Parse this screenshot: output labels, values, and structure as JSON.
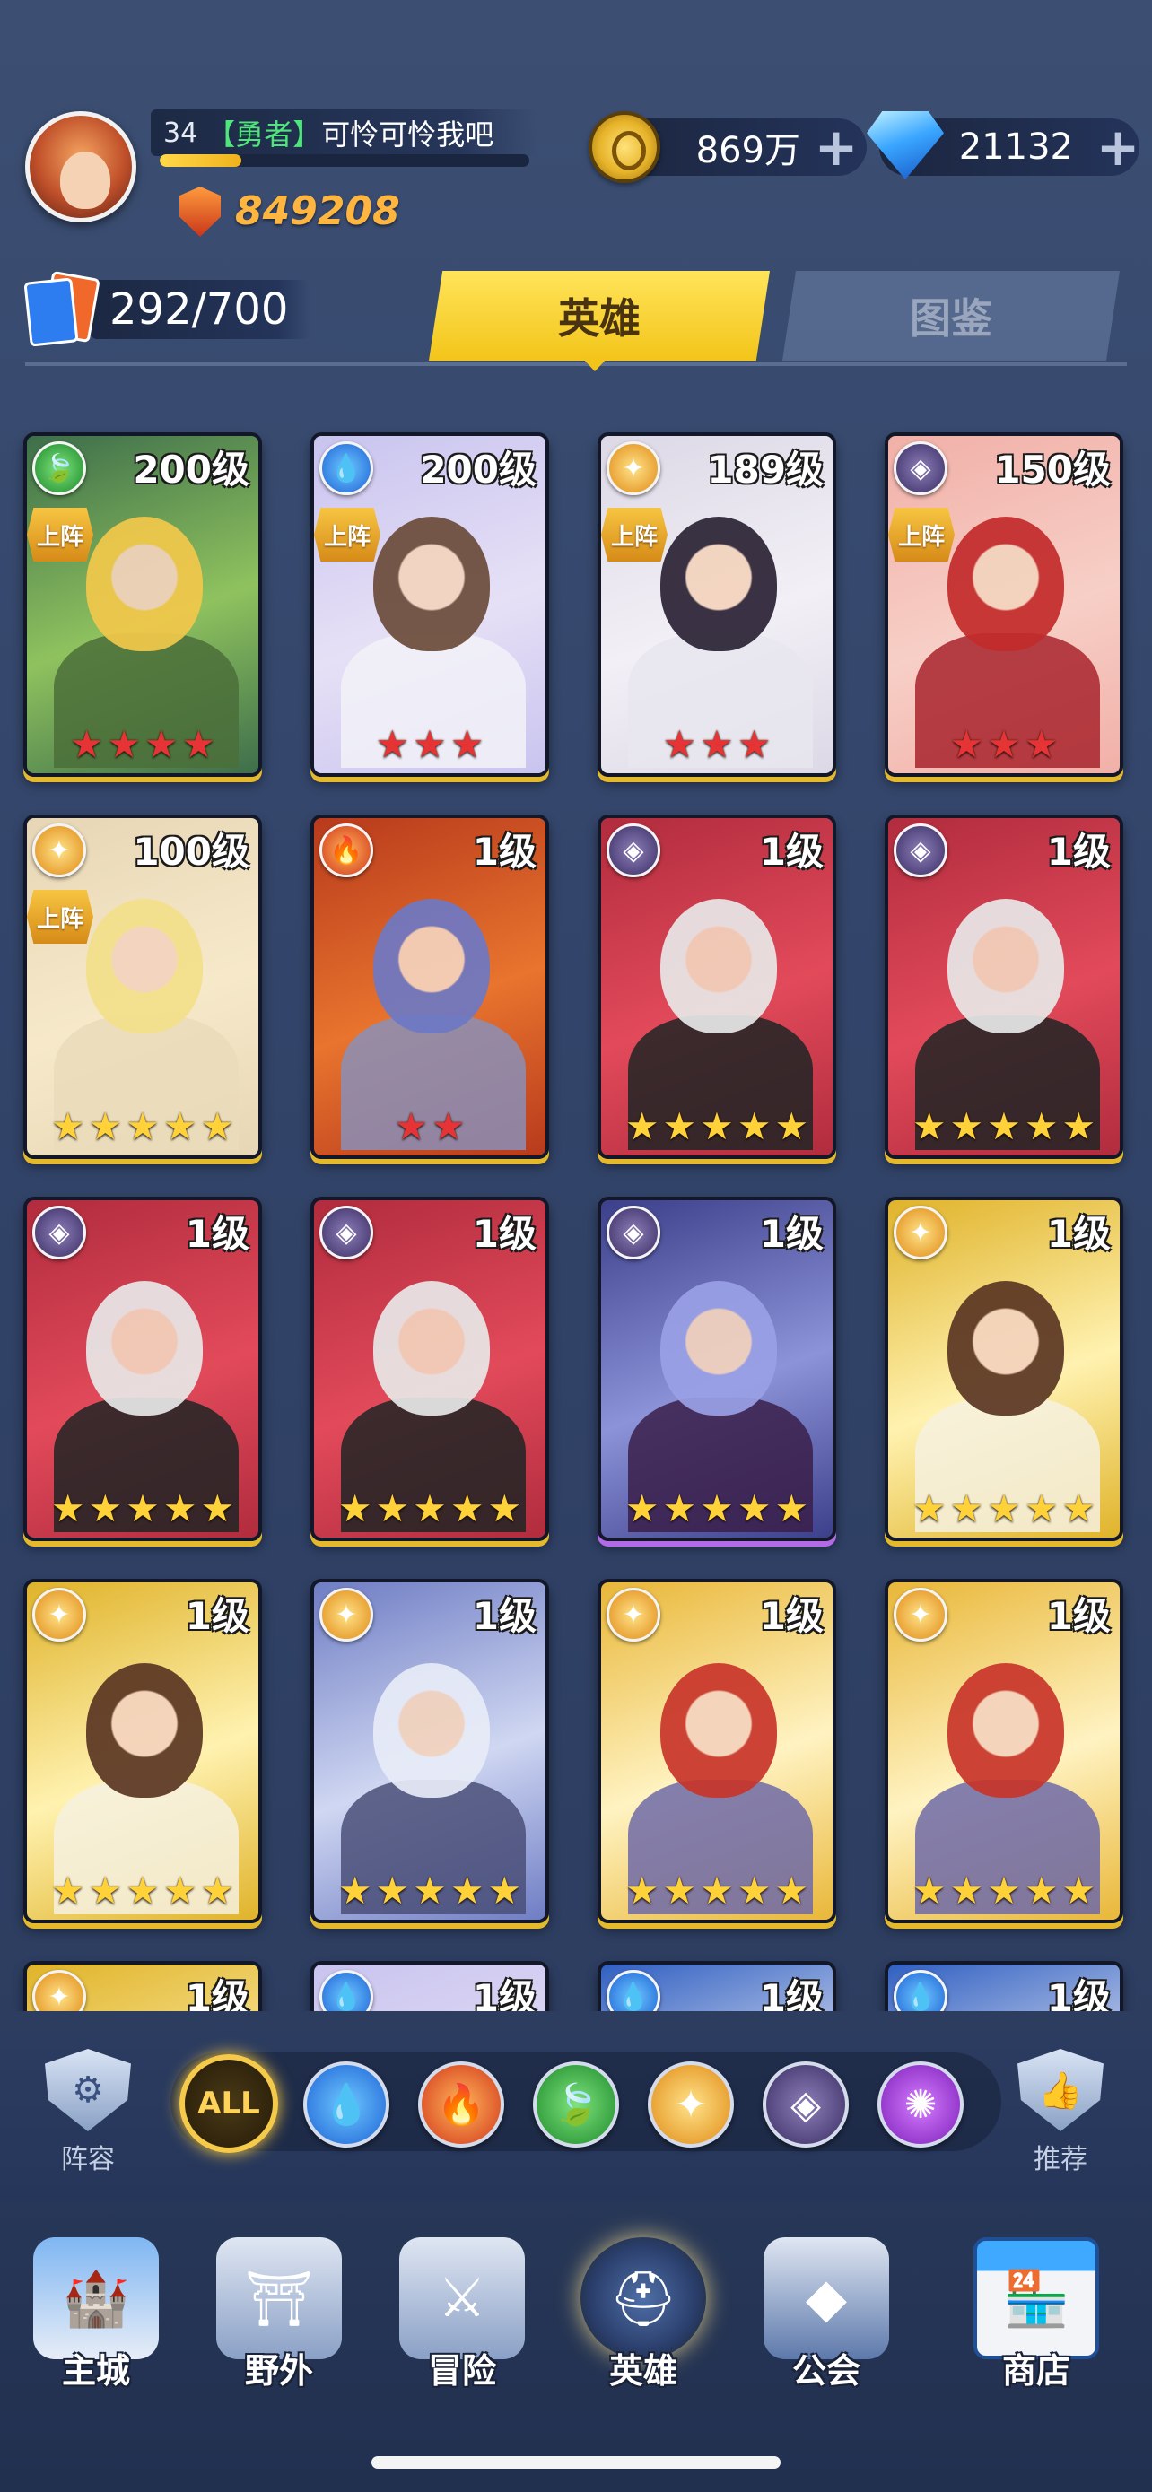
{
  "player": {
    "level": "34",
    "title_tag": "【勇者】",
    "name": "可怜可怜我吧",
    "exp_progress": 0.22,
    "power": "849208"
  },
  "resources": {
    "gold": "869万",
    "gems": "21132",
    "plus_label": "+"
  },
  "hero_count": "292/700",
  "tabs": [
    {
      "label": "英雄",
      "active": true
    },
    {
      "label": "图鉴",
      "active": false
    }
  ],
  "deploy_label": "上阵",
  "heroes": [
    {
      "level": "200级",
      "faction": "nature",
      "deployed": true,
      "stars": 4,
      "star_color": "red",
      "palette": "gold-green"
    },
    {
      "level": "200级",
      "faction": "water",
      "deployed": true,
      "stars": 3,
      "star_color": "red",
      "palette": "lavender"
    },
    {
      "level": "189级",
      "faction": "light",
      "deployed": true,
      "stars": 3,
      "star_color": "red",
      "palette": "dark-white"
    },
    {
      "level": "150级",
      "faction": "void",
      "deployed": true,
      "stars": 3,
      "star_color": "red",
      "palette": "crimson"
    },
    {
      "level": "100级",
      "faction": "light",
      "deployed": true,
      "stars": 5,
      "star_color": "gold",
      "palette": "blonde"
    },
    {
      "level": "1级",
      "faction": "fire",
      "deployed": false,
      "stars": 2,
      "star_color": "red",
      "palette": "brute"
    },
    {
      "level": "1级",
      "faction": "void",
      "deployed": false,
      "stars": 5,
      "star_color": "gold",
      "palette": "skull"
    },
    {
      "level": "1级",
      "faction": "void",
      "deployed": false,
      "stars": 5,
      "star_color": "gold",
      "palette": "skull"
    },
    {
      "level": "1级",
      "faction": "void",
      "deployed": false,
      "stars": 5,
      "star_color": "gold",
      "palette": "skull"
    },
    {
      "level": "1级",
      "faction": "void",
      "deployed": false,
      "stars": 5,
      "star_color": "gold",
      "palette": "skull"
    },
    {
      "level": "1级",
      "faction": "void",
      "deployed": false,
      "stars": 5,
      "star_color": "gold",
      "palette": "vampire"
    },
    {
      "level": "1级",
      "faction": "light",
      "deployed": false,
      "stars": 5,
      "star_color": "gold",
      "palette": "goddess"
    },
    {
      "level": "1级",
      "faction": "light",
      "deployed": false,
      "stars": 5,
      "star_color": "gold",
      "palette": "goddess"
    },
    {
      "level": "1级",
      "faction": "light",
      "deployed": false,
      "stars": 5,
      "star_color": "gold",
      "palette": "silver-elf"
    },
    {
      "level": "1级",
      "faction": "light",
      "deployed": false,
      "stars": 5,
      "star_color": "gold",
      "palette": "helm-red"
    },
    {
      "level": "1级",
      "faction": "light",
      "deployed": false,
      "stars": 5,
      "star_color": "gold",
      "palette": "helm-red"
    },
    {
      "level": "1级",
      "faction": "light",
      "deployed": false,
      "stars": 0,
      "star_color": "gold",
      "palette": "goddess"
    },
    {
      "level": "1级",
      "faction": "water",
      "deployed": false,
      "stars": 0,
      "star_color": "gold",
      "palette": "lavender"
    },
    {
      "level": "1级",
      "faction": "water",
      "deployed": false,
      "stars": 0,
      "star_color": "gold",
      "palette": "orange"
    },
    {
      "level": "1级",
      "faction": "water",
      "deployed": false,
      "stars": 0,
      "star_color": "gold",
      "palette": "orange"
    }
  ],
  "filters": {
    "left_label": "阵容",
    "right_label": "推荐",
    "all_label": "ALL",
    "factions": [
      "water",
      "fire",
      "nature",
      "light",
      "void",
      "arcane"
    ]
  },
  "nav": [
    {
      "label": "主城",
      "icon": "castle-icon",
      "active": false
    },
    {
      "label": "野外",
      "icon": "portal-icon",
      "active": false
    },
    {
      "label": "冒险",
      "icon": "trident-gate-icon",
      "active": false
    },
    {
      "label": "英雄",
      "icon": "knight-helmet-icon",
      "active": true
    },
    {
      "label": "公会",
      "icon": "guild-banner-icon",
      "active": false
    },
    {
      "label": "商店",
      "icon": "shop-icon",
      "active": false
    }
  ],
  "colors": {
    "accent_yellow": "#f3c51a",
    "gold_text": "#ffb640",
    "title_green": "#4fe57a"
  }
}
